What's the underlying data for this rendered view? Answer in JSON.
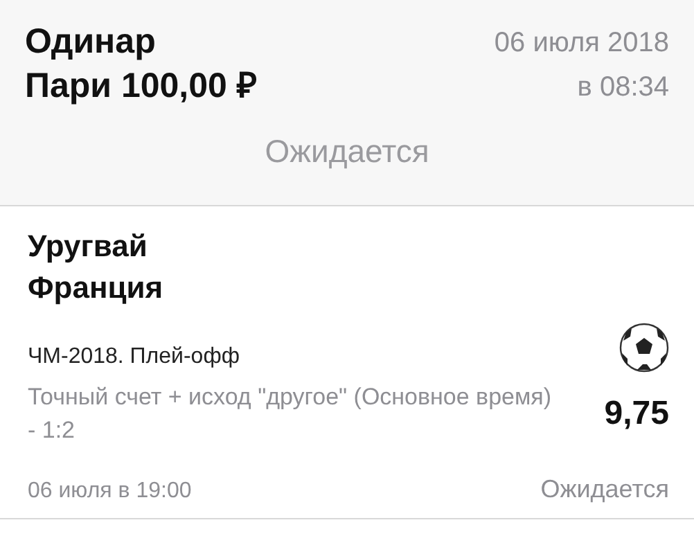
{
  "bet": {
    "type": "Одинар",
    "stake": "Пари 100,00 ₽",
    "date": "06 июля 2018",
    "time": "в 08:34",
    "status": "Ожидается"
  },
  "events": [
    {
      "teams": [
        "Уругвай",
        "Франция"
      ],
      "tournament": "ЧМ-2018. Плей-офф",
      "market": "Точный счет + исход \"другое\" (Основное время) - 1:2",
      "odds": "9,75",
      "start": "06 июля в 19:00",
      "status": "Ожидается"
    }
  ]
}
